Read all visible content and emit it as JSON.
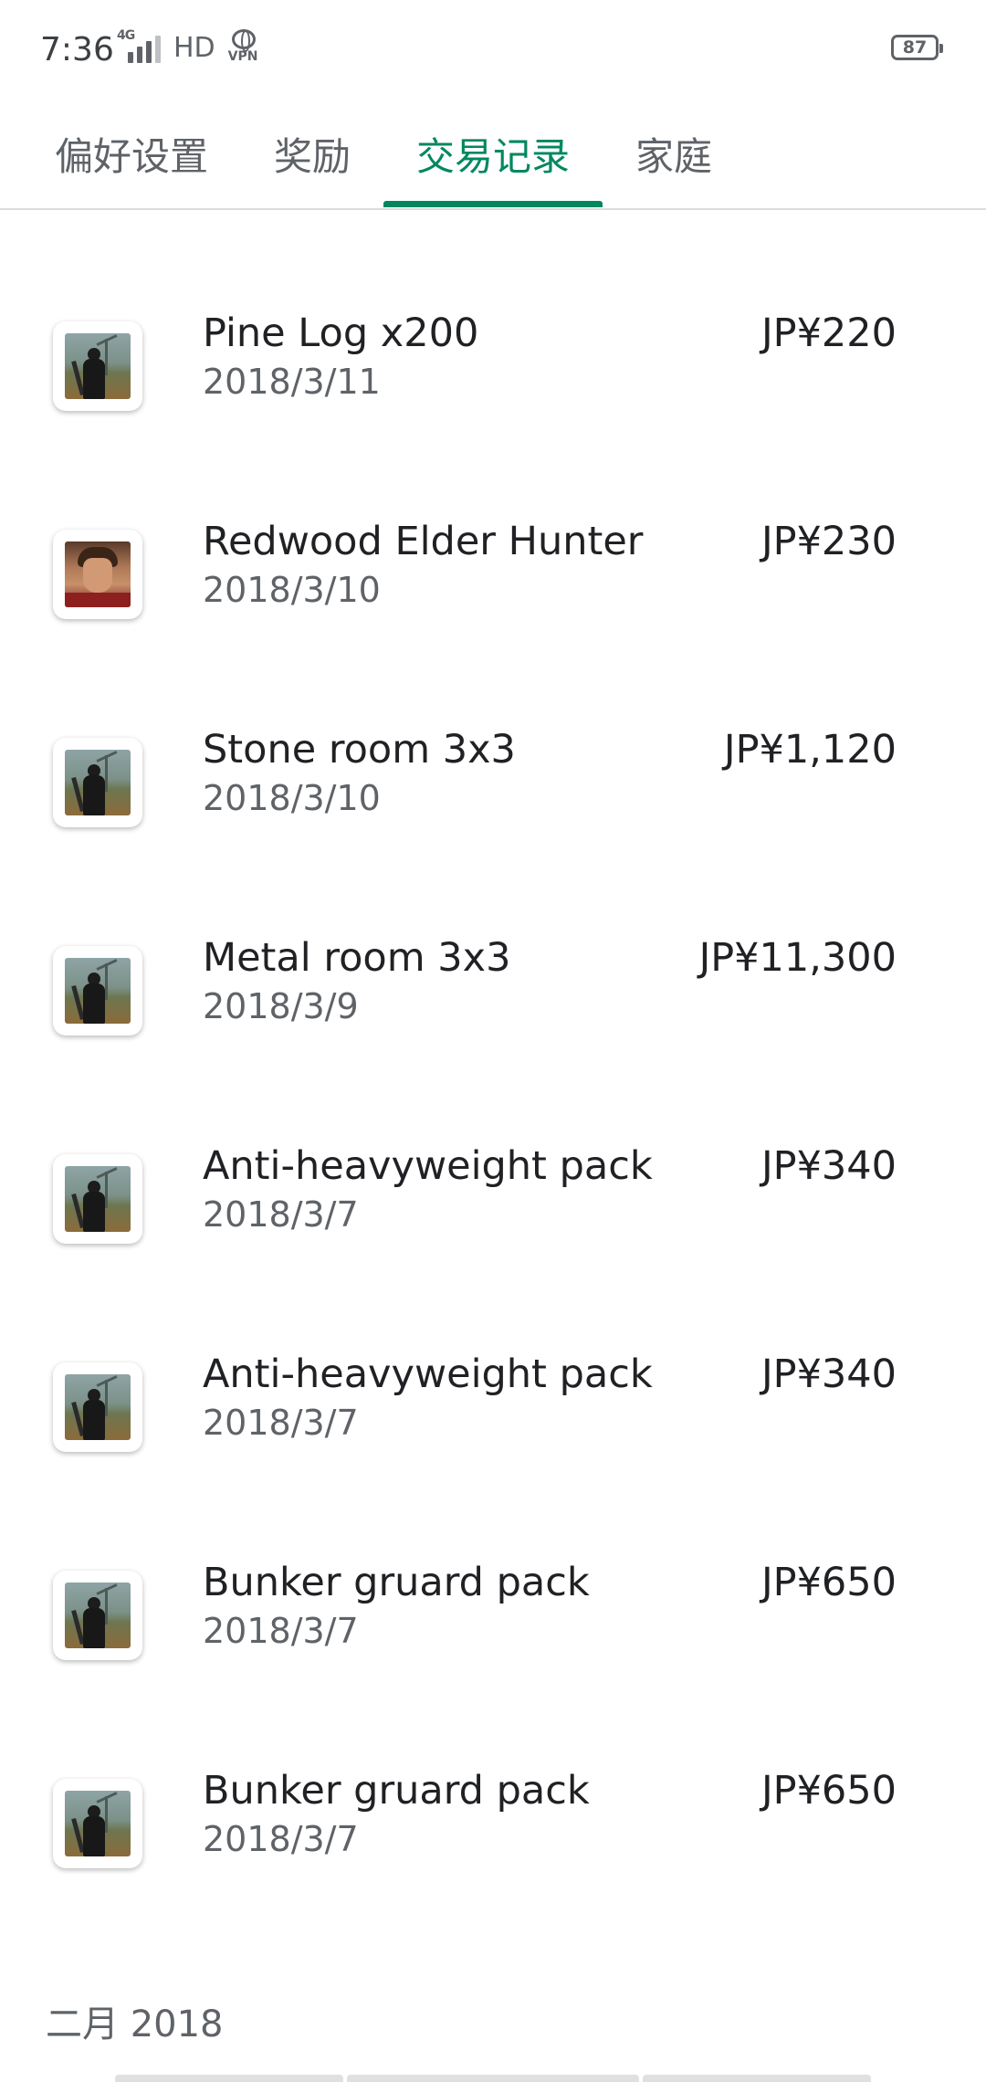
{
  "status_bar": {
    "time": "7:36",
    "network_label": "4G",
    "hd_label": "HD",
    "vpn_label": "VPN",
    "battery_level": "87"
  },
  "tabs": [
    {
      "label": "偏好设置",
      "active": false
    },
    {
      "label": "奖励",
      "active": false
    },
    {
      "label": "交易记录",
      "active": true
    },
    {
      "label": "家庭",
      "active": false
    }
  ],
  "accent_color": "#01875f",
  "transactions": [
    {
      "title": "Pine Log x200",
      "date": "2018/3/11",
      "price": "JP¥220",
      "icon": "survivor-game-icon"
    },
    {
      "title": "Redwood Elder Hunter",
      "date": "2018/3/10",
      "price": "JP¥230",
      "icon": "hunter-portrait-icon"
    },
    {
      "title": "Stone room 3x3",
      "date": "2018/3/10",
      "price": "JP¥1,120",
      "icon": "survivor-game-icon"
    },
    {
      "title": "Metal room 3x3",
      "date": "2018/3/9",
      "price": "JP¥11,300",
      "icon": "survivor-game-icon"
    },
    {
      "title": "Anti-heavyweight pack",
      "date": "2018/3/7",
      "price": "JP¥340",
      "icon": "survivor-game-icon"
    },
    {
      "title": "Anti-heavyweight pack",
      "date": "2018/3/7",
      "price": "JP¥340",
      "icon": "survivor-game-icon"
    },
    {
      "title": "Bunker gruard pack",
      "date": "2018/3/7",
      "price": "JP¥650",
      "icon": "survivor-game-icon"
    },
    {
      "title": "Bunker gruard pack",
      "date": "2018/3/7",
      "price": "JP¥650",
      "icon": "survivor-game-icon"
    }
  ],
  "month_section": "二月 2018"
}
